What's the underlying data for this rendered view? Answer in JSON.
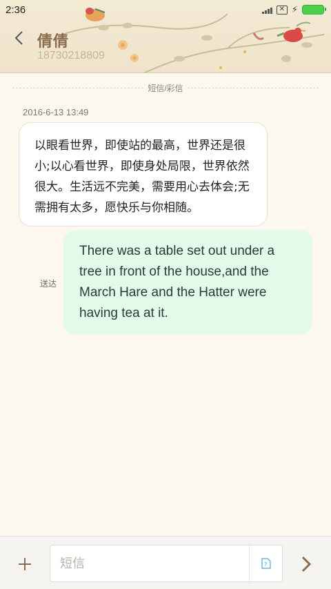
{
  "status_bar": {
    "time": "2:36"
  },
  "header": {
    "contact_name": "倩倩",
    "contact_number": "18730218809"
  },
  "conversation": {
    "divider_label": "短信/彩信",
    "incoming": {
      "timestamp": "2016-6-13 13:49",
      "text": "以眼看世界，即使站的最高，世界还是很小;以心看世界，即使身处局限，世界依然很大。生活远不完美，需要用心去体会;无需拥有太多，愿快乐与你相随。"
    },
    "outgoing": {
      "status": "送达",
      "text": "There was a table set out under a tree in front of the house,and the March Hare and the Hatter were having tea at it."
    }
  },
  "composer": {
    "placeholder": "短信",
    "value": ""
  },
  "colors": {
    "accent_brown": "#8b6a4e",
    "outgoing_bubble": "#e3f9ea",
    "background": "#fdf8ef"
  },
  "icons": [
    "back-arrow-icon",
    "add-icon",
    "sim-card-icon",
    "send-arrow-icon",
    "battery-icon",
    "signal-icon",
    "no-sim-icon",
    "charging-icon"
  ]
}
